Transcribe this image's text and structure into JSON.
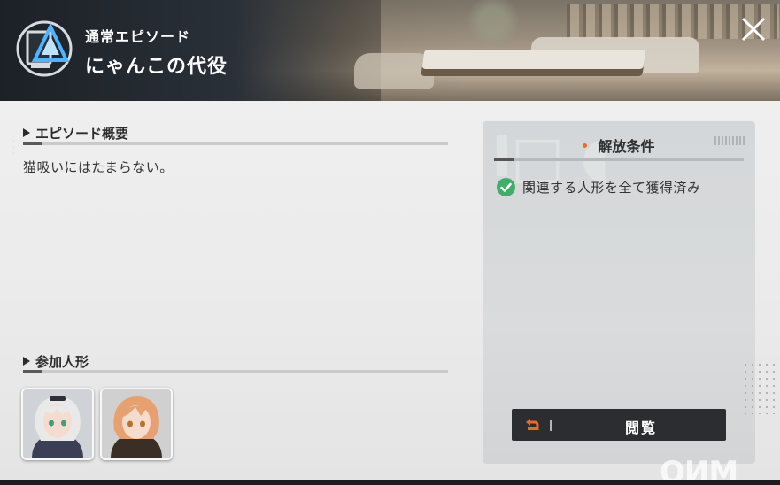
{
  "header": {
    "episode_type": "通常エピソード",
    "episode_title": "にゃんこの代役"
  },
  "summary_section": {
    "heading": "エピソード概要",
    "text": "猫吸いにはたまらない。"
  },
  "participants_section": {
    "heading": "参加人形",
    "dolls": [
      {
        "hair": "#e9e9ea",
        "eyes": "#3fa07a"
      },
      {
        "hair": "#e7a06f",
        "eyes": "#b5742c"
      }
    ]
  },
  "conditions": {
    "title": "解放条件",
    "items": [
      "関連する人形を全て獲得済み"
    ]
  },
  "view_button": {
    "label": "閲覧"
  },
  "colors": {
    "accent_orange": "#f06a1e",
    "check_green": "#3fae6a",
    "button_dark": "#2b2d30"
  }
}
